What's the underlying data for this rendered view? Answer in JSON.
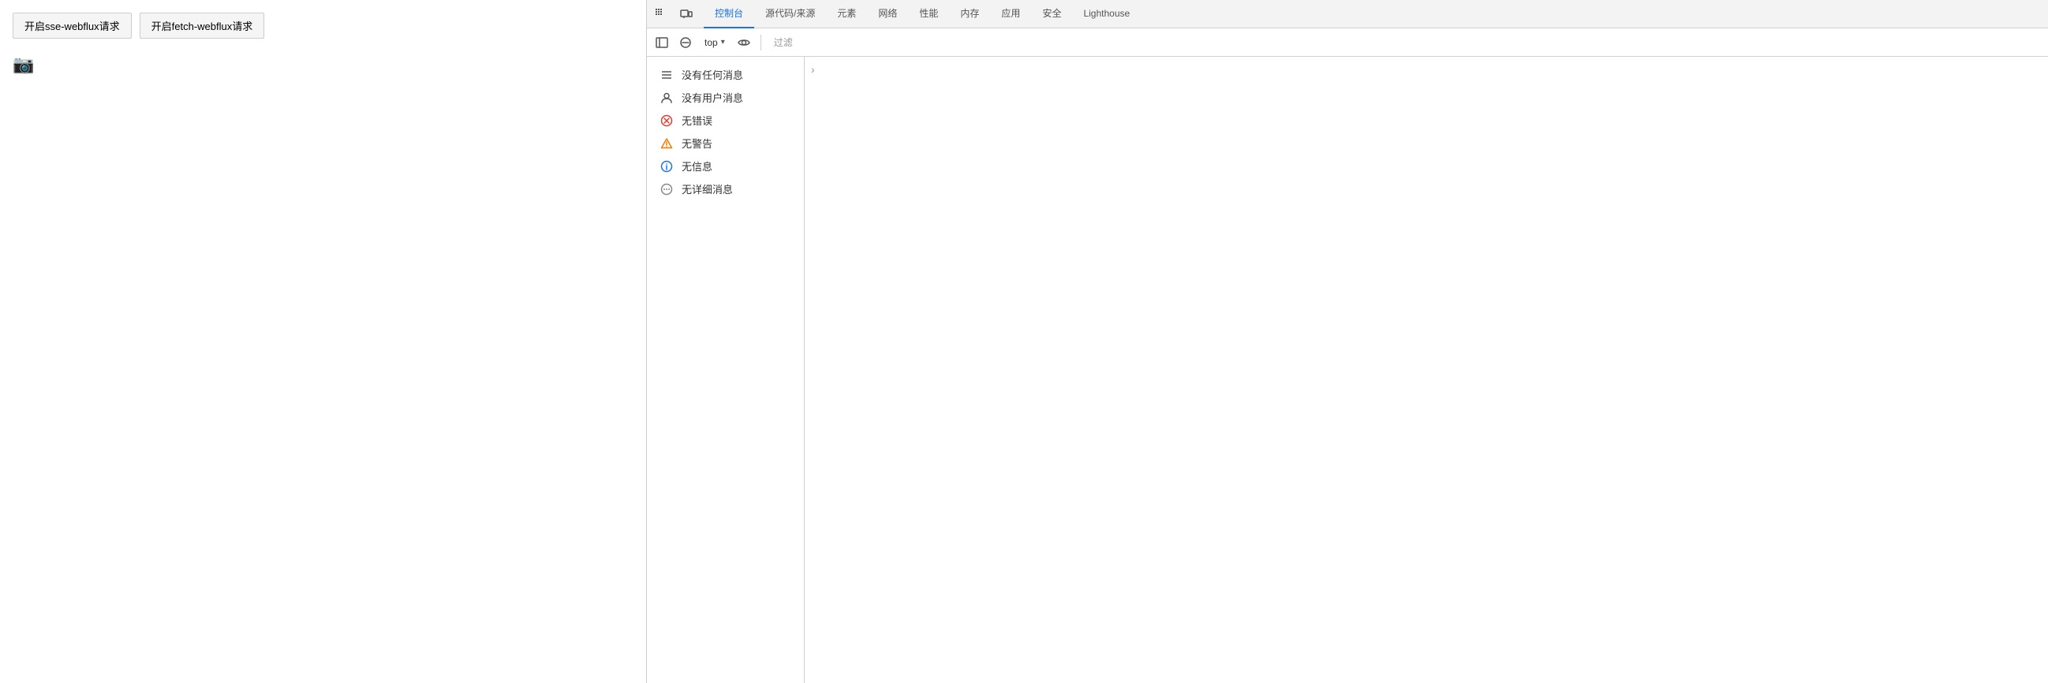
{
  "webpage": {
    "button1_label": "开启sse-webflux请求",
    "button2_label": "开启fetch-webflux请求"
  },
  "devtools": {
    "tabs": [
      {
        "id": "elements",
        "label": "元素"
      },
      {
        "id": "console",
        "label": "控制台",
        "active": true
      },
      {
        "id": "sources",
        "label": "源代码/来源"
      },
      {
        "id": "dom",
        "label": "元素"
      },
      {
        "id": "network",
        "label": "网络"
      },
      {
        "id": "performance",
        "label": "性能"
      },
      {
        "id": "memory",
        "label": "内存"
      },
      {
        "id": "application",
        "label": "应用"
      },
      {
        "id": "security",
        "label": "安全"
      },
      {
        "id": "lighthouse",
        "label": "Lighthouse"
      }
    ],
    "toolbar": {
      "context_label": "top",
      "filter_placeholder": "过滤"
    },
    "filter_items": [
      {
        "id": "all",
        "label": "没有任何消息",
        "icon_type": "list"
      },
      {
        "id": "user",
        "label": "没有用户消息",
        "icon_type": "user"
      },
      {
        "id": "errors",
        "label": "无错误",
        "icon_type": "error"
      },
      {
        "id": "warnings",
        "label": "无警告",
        "icon_type": "warning"
      },
      {
        "id": "info",
        "label": "无信息",
        "icon_type": "info"
      },
      {
        "id": "verbose",
        "label": "无详细消息",
        "icon_type": "verbose"
      }
    ]
  }
}
